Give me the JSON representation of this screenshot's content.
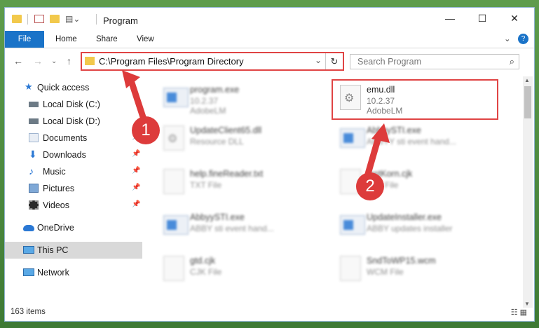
{
  "window": {
    "title": "Program",
    "controls": {
      "minimize": "—",
      "maximize": "☐",
      "close": "✕"
    }
  },
  "ribbon": {
    "tabs": [
      "File",
      "Home",
      "Share",
      "View"
    ],
    "expand": "⌄",
    "help": "?"
  },
  "address_bar": {
    "path": "C:\\Program Files\\Program Directory",
    "dropdown": "⌄",
    "refresh": "↻"
  },
  "nav_buttons": {
    "back": "←",
    "forward": "→",
    "dropdown": "⌄",
    "up": "↑"
  },
  "search": {
    "placeholder": "Search Program",
    "icon": "search-icon"
  },
  "nav_pane": {
    "items": [
      {
        "label": "Quick access",
        "icon": "star-icon"
      },
      {
        "label": "Local Disk (C:)",
        "icon": "drive-icon"
      },
      {
        "label": "Local Disk (D:)",
        "icon": "drive-icon"
      },
      {
        "label": "Documents",
        "icon": "documents-icon",
        "pinned": true
      },
      {
        "label": "Downloads",
        "icon": "downloads-icon",
        "pinned": true
      },
      {
        "label": "Music",
        "icon": "music-icon",
        "pinned": true
      },
      {
        "label": "Pictures",
        "icon": "pictures-icon",
        "pinned": true
      },
      {
        "label": "Videos",
        "icon": "videos-icon",
        "pinned": true
      },
      {
        "label": "OneDrive",
        "icon": "cloud-icon"
      },
      {
        "label": "This PC",
        "icon": "computer-icon",
        "selected": true
      },
      {
        "label": "Network",
        "icon": "network-icon"
      }
    ]
  },
  "files": [
    {
      "name": "program.exe",
      "line2": "10.2.37",
      "line3": "AdobeLM",
      "type": "exe"
    },
    {
      "name": "emu.dll",
      "line2": "10.2.37",
      "line3": "AdobeLM",
      "type": "dll",
      "highlighted": true
    },
    {
      "name": "UpdateClient65.dll",
      "line2": "Resource DLL",
      "type": "dll"
    },
    {
      "name": "AbbyySTI.exe",
      "line2": "ABBYY sti event hand...",
      "type": "exe"
    },
    {
      "name": "help.fineReader.txt",
      "line2": "TXT File",
      "type": "txt"
    },
    {
      "name": "testKorn.cjk",
      "line2": "CJK File",
      "type": "txt"
    },
    {
      "name": "AbbyySTI.exe",
      "line2": "ABBY sti event hand...",
      "type": "exe"
    },
    {
      "name": "UpdateInstaller.exe",
      "line2": "ABBY updates installer",
      "type": "exe"
    },
    {
      "name": "gtd.cjk",
      "line2": "CJK File",
      "type": "txt"
    },
    {
      "name": "SndToWP15.wcm",
      "line2": "WCM File",
      "type": "txt"
    }
  ],
  "status_bar": {
    "item_count": "163 items",
    "view_icons": "☷ ▦"
  },
  "callouts": [
    "1",
    "2"
  ],
  "colors": {
    "accent": "#1a73c8",
    "highlight": "#e04444",
    "callout": "#dd3b3b"
  }
}
